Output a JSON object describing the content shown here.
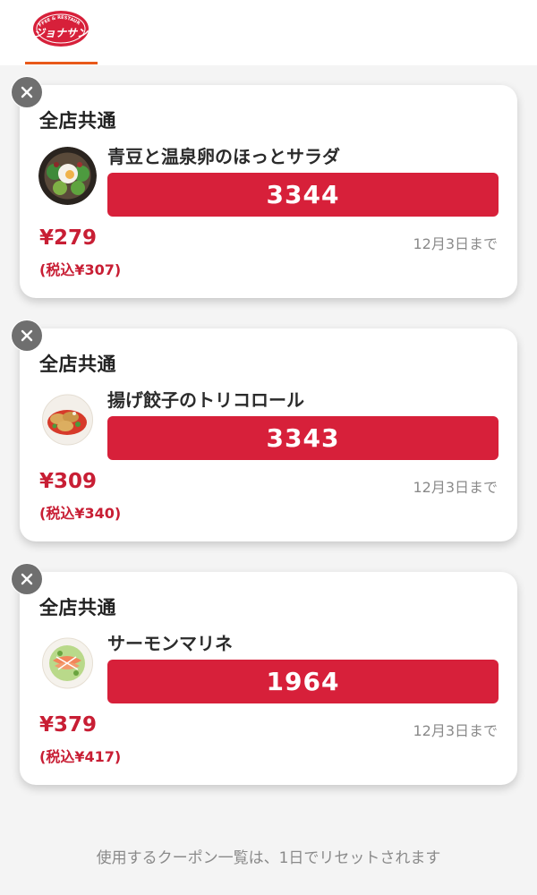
{
  "brand": {
    "logo_top_text": "COFFEE & RESTAURANT",
    "logo_main_text": "ジョナサン",
    "logo_color": "#d7203a",
    "tab_underline_color": "#e8591a"
  },
  "coupons": [
    {
      "store_label": "全店共通",
      "item_name": "青豆と温泉卵のほっとサラダ",
      "code": "3344",
      "price": "¥279",
      "price_tax": "(税込¥307)",
      "expiry": "12月3日まで",
      "thumb_icon": "salad-egg-food-icon"
    },
    {
      "store_label": "全店共通",
      "item_name": "揚げ餃子のトリコロール",
      "code": "3343",
      "price": "¥309",
      "price_tax": "(税込¥340)",
      "expiry": "12月3日まで",
      "thumb_icon": "fried-gyoza-food-icon"
    },
    {
      "store_label": "全店共通",
      "item_name": "サーモンマリネ",
      "code": "1964",
      "price": "¥379",
      "price_tax": "(税込¥417)",
      "expiry": "12月3日まで",
      "thumb_icon": "salmon-marinade-food-icon"
    }
  ],
  "footer": {
    "note": "使用するクーポン一覧は、1日でリセットされます"
  },
  "colors": {
    "code_bar": "#d7203a",
    "price": "#c81e34",
    "close_button": "#6f6f6f"
  }
}
